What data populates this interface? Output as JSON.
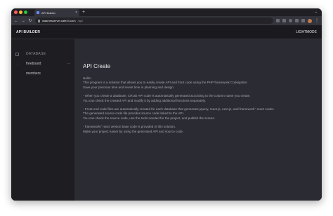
{
  "browser": {
    "tab_title": "API Builder",
    "tab_close": "×",
    "new_tab": "+",
    "tab_menu": "⌄",
    "url_host": "waamesserver.cafe24.com",
    "url_path": "/api/",
    "nav": {
      "back": "←",
      "forward": "→",
      "reload": "↻"
    },
    "menu": "⋮"
  },
  "app": {
    "title": "API BUILDER",
    "lightmode_label": "LIGHTMODE"
  },
  "sidebar": {
    "section_label": "DATABASE",
    "items": [
      {
        "label": "freeboard",
        "more": "···"
      },
      {
        "label": "members"
      }
    ]
  },
  "main": {
    "title": "API Create",
    "paragraphs": [
      [
        "Hello!",
        "This program is a solution that allows you to easily create API and front code using the PHP framework Codeigniter.",
        "Save your precious time and invest time in planning and design."
      ],
      [
        "- When you create a database, CRUD API code is automatically generated according to the column name you create.",
        "You can check the created API and modify it by adding additional functions separately."
      ],
      [
        "- Front-end code files are automatically created for each database that generates jquery, react.js, next.js, and frameworkᐟ-react codes",
        "The generated source code file provides source code linked to the API.",
        "You can check the source code, use the tools needed for the project, and publish the screen."
      ],
      [
        "- framework7 react version base code is provided in this solution.",
        "Make your project easier by using the generated API and source code."
      ]
    ]
  },
  "colors": {
    "window_bg": "#2b2b33",
    "sidebar_bg": "#1e1e22",
    "header_bg": "#1a1a1e",
    "text_primary": "#e8e8ec",
    "text_secondary": "#a8a8b0"
  },
  "icons": {
    "sidebar_section": "database-icon",
    "sidebar_item": "table-icon"
  }
}
